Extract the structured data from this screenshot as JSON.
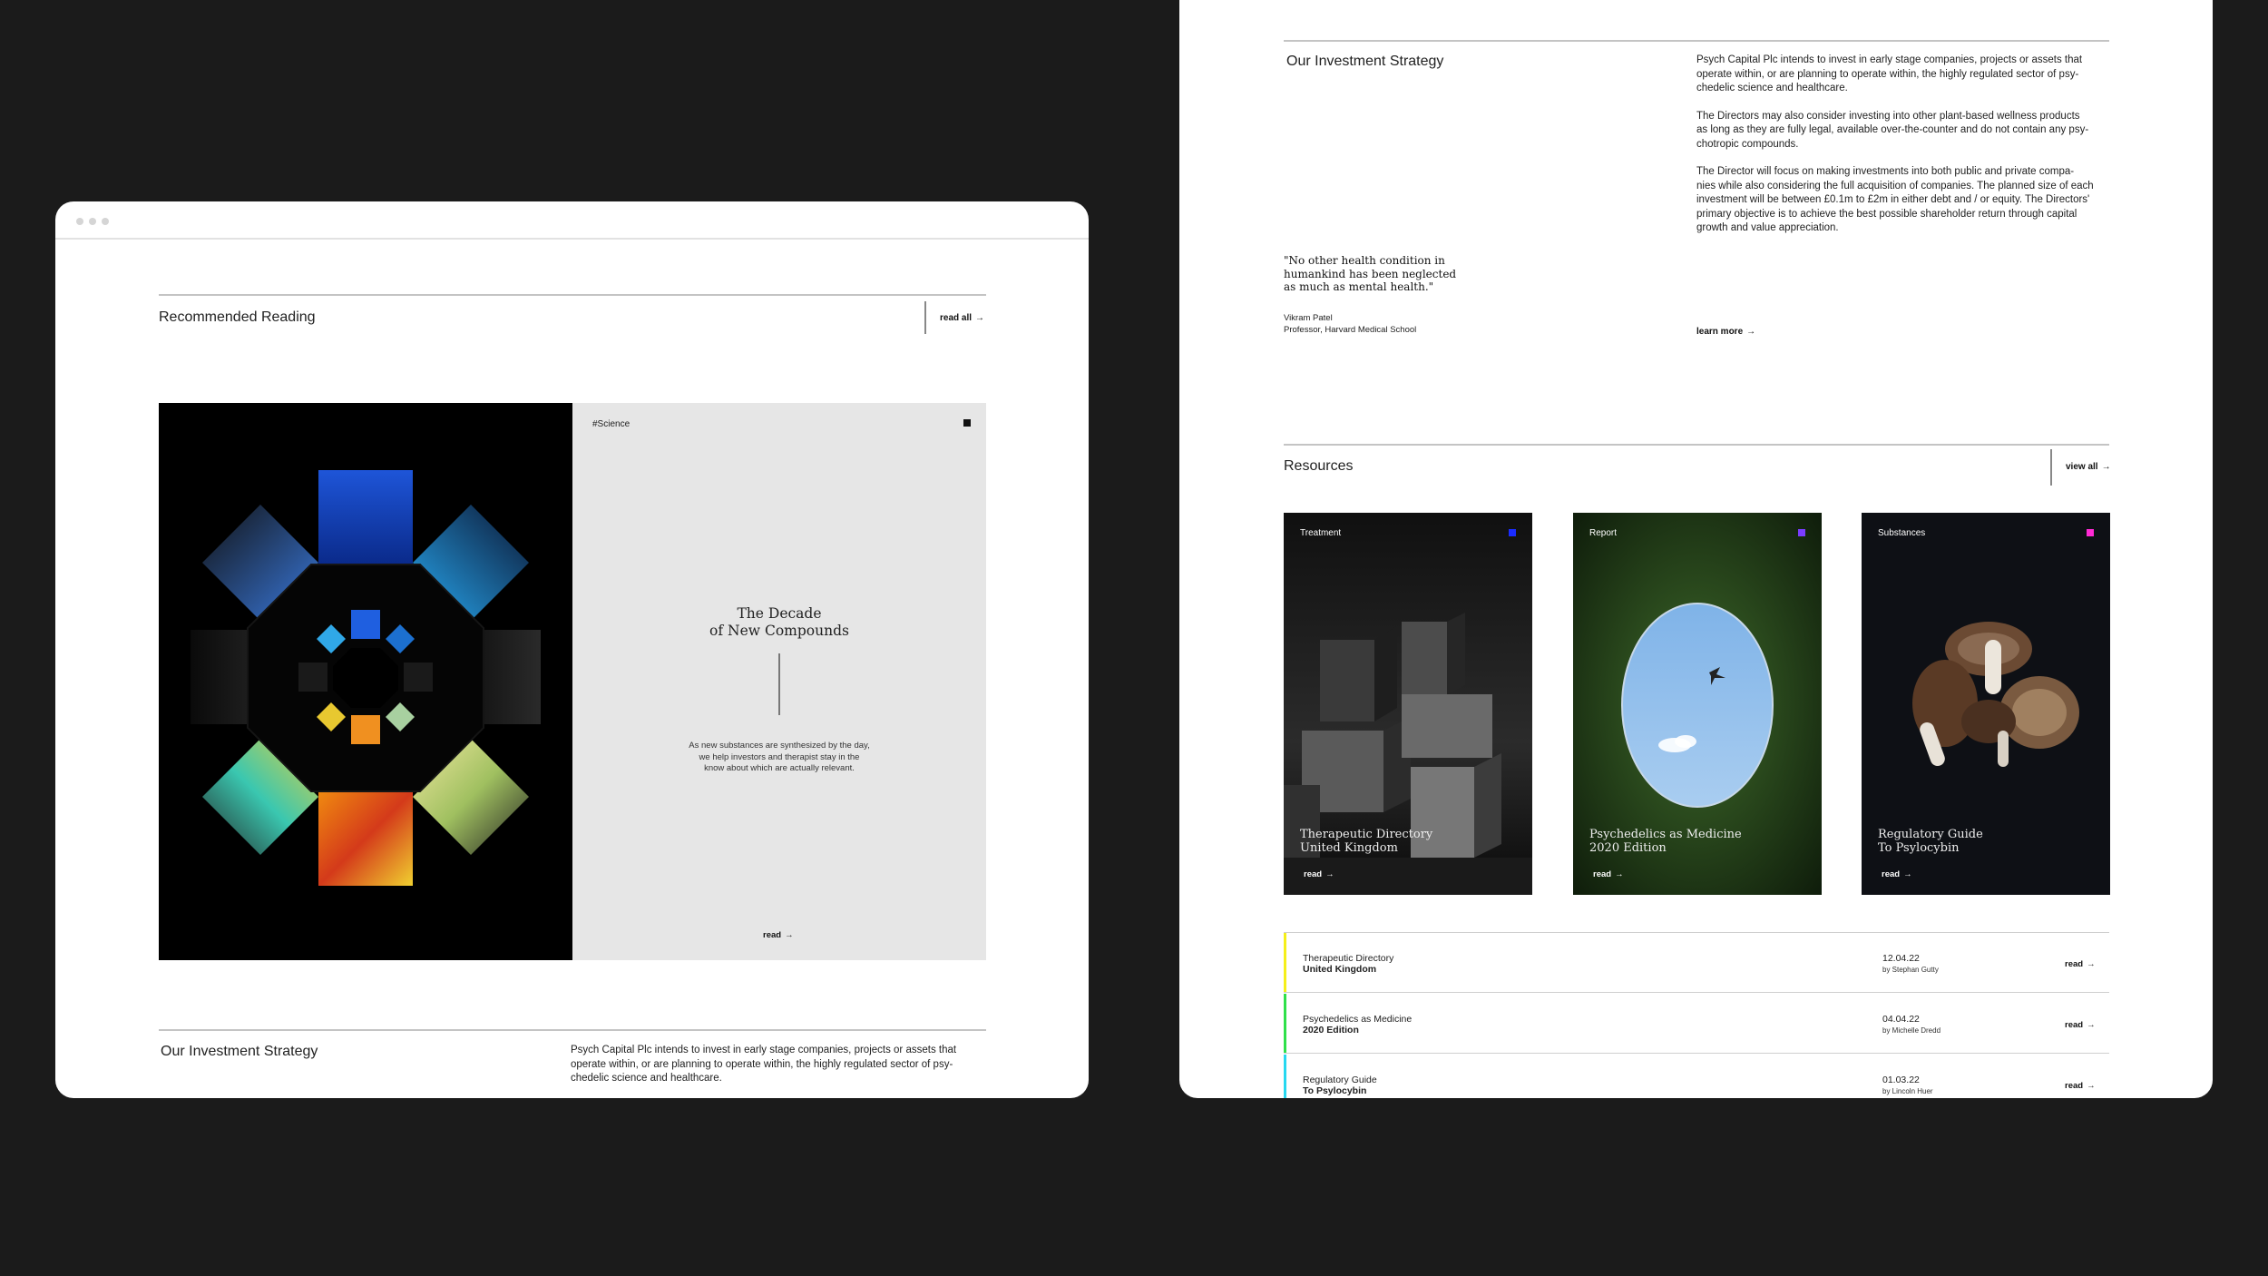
{
  "left_window": {
    "recommended": {
      "title": "Recommended Reading",
      "read_all": "read all",
      "arrow": "→"
    },
    "feature": {
      "tag": "#Science",
      "title_line1": "The Decade",
      "title_line2": "of New Compounds",
      "description_line1": "As new substances are synthesized by the day,",
      "description_line2": "we help investors and therapist stay in the",
      "description_line3": "know about which are actually relevant.",
      "read": "read"
    },
    "strategy": {
      "title": "Our Investment Strategy",
      "p1_line1": "Psych Capital Plc intends to invest in early stage companies, projects or assets that",
      "p1_line2": "operate within, or are planning to operate within, the highly regulated sector of psy-",
      "p1_line3": "chedelic science and healthcare."
    }
  },
  "right_window": {
    "strategy": {
      "title": "Our Investment Strategy",
      "p1_line1": "Psych Capital Plc intends to invest in early stage companies, projects or assets that",
      "p1_line2": "operate within, or are planning to operate within, the highly regulated sector of psy-",
      "p1_line3": "chedelic science and healthcare.",
      "p2_line1": "The Directors may also consider investing into other plant-based wellness products",
      "p2_line2": "as long as they are fully legal, available over-the-counter and do not contain any psy-",
      "p2_line3": "chotropic compounds.",
      "p3_line1": "The Director will focus on making investments into both public and private compa-",
      "p3_line2": "nies while also considering the full acquisition of companies. The planned size of each",
      "p3_line3": "investment will be between £0.1m to £2m in either debt and / or equity. The Directors'",
      "p3_line4": "primary objective is to achieve the best possible shareholder return through capital",
      "p3_line5": "growth and value appreciation.",
      "learn_more": "learn more",
      "quote_line1": "\"No other health condition in",
      "quote_line2": "humankind has been neglected",
      "quote_line3": "as much as mental health.\"",
      "author": "Vikram Patel",
      "author_role": "Professor, Harvard Medical School"
    },
    "resources": {
      "title": "Resources",
      "view_all": "view all",
      "cards": [
        {
          "tag": "Treatment",
          "title_line1": "Therapeutic Directory",
          "title_line2": "United Kingdom",
          "read": "read",
          "color": "#1a2cff"
        },
        {
          "tag": "Report",
          "title_line1": "Psychedelics as Medicine",
          "title_line2": "2020 Edition",
          "read": "read",
          "color": "#7a3cff"
        },
        {
          "tag": "Substances",
          "title_line1": "Regulatory Guide",
          "title_line2": "To Psylocybin",
          "read": "read",
          "color": "#ff2ad4"
        }
      ],
      "list": [
        {
          "title_line1": "Therapeutic Directory",
          "title_line2": "United Kingdom",
          "date": "12.04.22",
          "author": "by Stephan Gutty",
          "read": "read",
          "color": "#f5ef1a"
        },
        {
          "title_line1": "Psychedelics as Medicine",
          "title_line2": "2020 Edition",
          "date": "04.04.22",
          "author": "by Michelle Dredd",
          "read": "read",
          "color": "#2fe04a"
        },
        {
          "title_line1": "Regulatory Guide",
          "title_line2": "To Psylocybin",
          "date": "01.03.22",
          "author": "by Lincoln Huer",
          "read": "read",
          "color": "#27d8f0"
        }
      ]
    }
  }
}
